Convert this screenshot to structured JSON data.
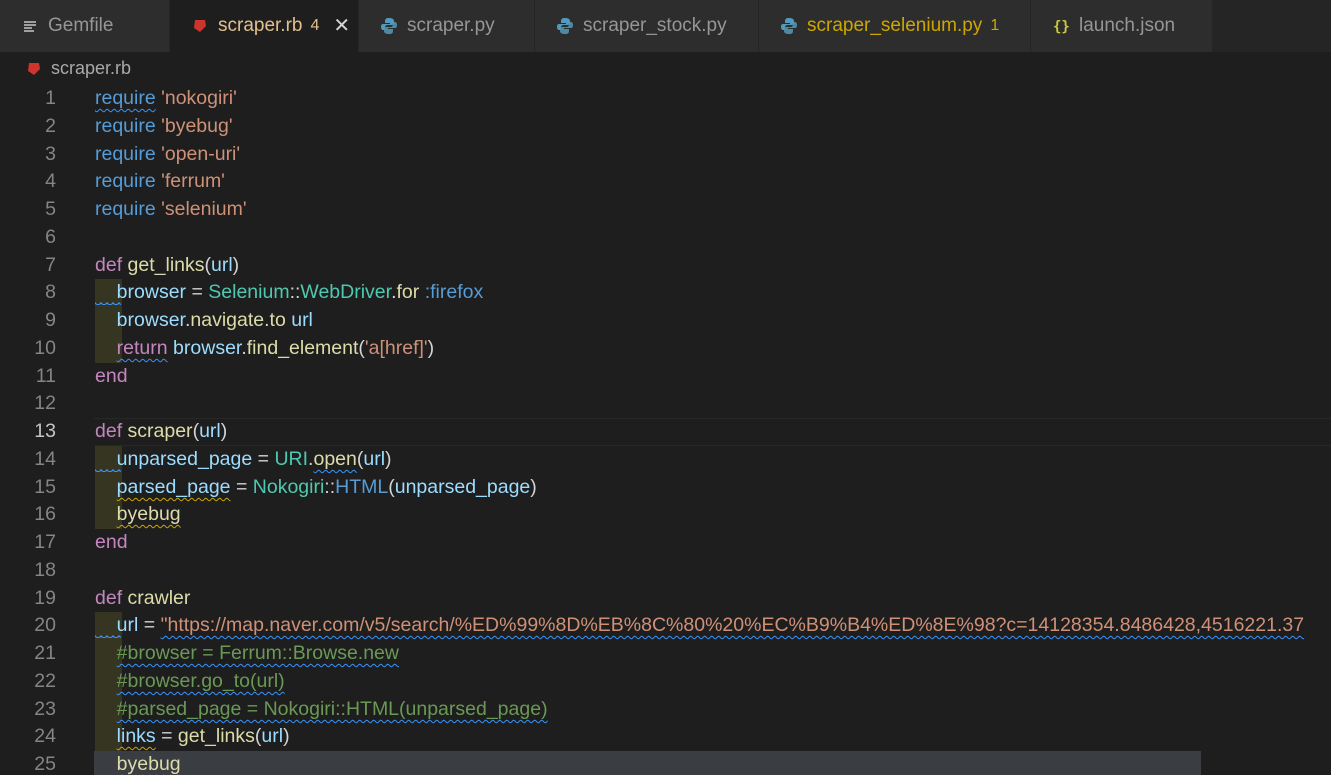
{
  "tabs": [
    {
      "label": "Gemfile",
      "icon": "lines-icon",
      "active": false,
      "badge": "",
      "status": "none"
    },
    {
      "label": "scraper.rb",
      "icon": "ruby-icon",
      "active": true,
      "badge": "4",
      "status": "modified"
    },
    {
      "label": "scraper.py",
      "icon": "python-icon",
      "active": false,
      "badge": "",
      "status": "none"
    },
    {
      "label": "scraper_stock.py",
      "icon": "python-icon",
      "active": false,
      "badge": "",
      "status": "none"
    },
    {
      "label": "scraper_selenium.py",
      "icon": "python-icon",
      "active": false,
      "badge": "1",
      "status": "warning"
    },
    {
      "label": "launch.json",
      "icon": "braces-icon",
      "active": false,
      "badge": "",
      "status": "none"
    }
  ],
  "breadcrumb": {
    "file": "scraper.rb",
    "icon": "ruby-icon"
  },
  "colors": {
    "ruby": "#cc342d",
    "python": "#519aba",
    "json": "#cbcb41",
    "keyword": "#569cd6",
    "control": "#c586c0",
    "string": "#ce9178",
    "function": "#dcdcaa",
    "variable": "#9cdcfe",
    "class": "#4ec9b0",
    "comment": "#6a9955"
  },
  "editor": {
    "current_line": 13,
    "lines": [
      {
        "n": "1",
        "t": [
          [
            "kw sq-b",
            "require"
          ],
          [
            "p",
            " "
          ],
          [
            "str",
            "'nokogiri'"
          ]
        ]
      },
      {
        "n": "2",
        "t": [
          [
            "kw",
            "require"
          ],
          [
            "p",
            " "
          ],
          [
            "str",
            "'byebug'"
          ]
        ]
      },
      {
        "n": "3",
        "t": [
          [
            "kw",
            "require"
          ],
          [
            "p",
            " "
          ],
          [
            "str",
            "'open-uri'"
          ]
        ]
      },
      {
        "n": "4",
        "t": [
          [
            "kw",
            "require"
          ],
          [
            "p",
            " "
          ],
          [
            "str",
            "'ferrum'"
          ]
        ]
      },
      {
        "n": "5",
        "t": [
          [
            "kw",
            "require"
          ],
          [
            "p",
            " "
          ],
          [
            "str",
            "'selenium'"
          ]
        ]
      },
      {
        "n": "6",
        "t": []
      },
      {
        "n": "7",
        "t": [
          [
            "kd",
            "def"
          ],
          [
            "p",
            " "
          ],
          [
            "fn",
            "get_links"
          ],
          [
            "p",
            "("
          ],
          [
            "var",
            "url"
          ],
          [
            "p",
            ")"
          ]
        ]
      },
      {
        "n": "8",
        "indent": true,
        "sq": true,
        "t": [
          [
            "p",
            "    "
          ],
          [
            "var",
            "browser"
          ],
          [
            "p",
            " = "
          ],
          [
            "cls",
            "Selenium"
          ],
          [
            "p",
            "::"
          ],
          [
            "cls",
            "WebDriver"
          ],
          [
            "p",
            "."
          ],
          [
            "fn",
            "for"
          ],
          [
            "p",
            " "
          ],
          [
            "sym",
            ":firefox"
          ]
        ]
      },
      {
        "n": "9",
        "indent": true,
        "t": [
          [
            "p",
            "    "
          ],
          [
            "var",
            "browser"
          ],
          [
            "p",
            "."
          ],
          [
            "fn",
            "navigate"
          ],
          [
            "p",
            "."
          ],
          [
            "fn",
            "to"
          ],
          [
            "p",
            " "
          ],
          [
            "var",
            "url"
          ]
        ]
      },
      {
        "n": "10",
        "indent": true,
        "t": [
          [
            "p",
            "    "
          ],
          [
            "kd sq-b",
            "return"
          ],
          [
            "p",
            " "
          ],
          [
            "var",
            "browser"
          ],
          [
            "p",
            "."
          ],
          [
            "fn",
            "find_element"
          ],
          [
            "p",
            "("
          ],
          [
            "str",
            "'a[href]'"
          ],
          [
            "p",
            ")"
          ]
        ]
      },
      {
        "n": "11",
        "t": [
          [
            "kd",
            "end"
          ]
        ]
      },
      {
        "n": "12",
        "t": []
      },
      {
        "n": "13",
        "t": [
          [
            "kd",
            "def"
          ],
          [
            "p",
            " "
          ],
          [
            "fn",
            "scraper"
          ],
          [
            "p",
            "("
          ],
          [
            "var",
            "url"
          ],
          [
            "p",
            ")"
          ]
        ]
      },
      {
        "n": "14",
        "indent": true,
        "sq": true,
        "t": [
          [
            "p",
            "    "
          ],
          [
            "var",
            "unparsed_page"
          ],
          [
            "p",
            " = "
          ],
          [
            "cls",
            "URI"
          ],
          [
            "p",
            "."
          ],
          [
            "fn sq-b",
            "open"
          ],
          [
            "p",
            "("
          ],
          [
            "var",
            "url"
          ],
          [
            "p",
            ")"
          ]
        ]
      },
      {
        "n": "15",
        "indent": true,
        "t": [
          [
            "p",
            "    "
          ],
          [
            "var sq-y",
            "parsed_page"
          ],
          [
            "p",
            " = "
          ],
          [
            "cls",
            "Nokogiri"
          ],
          [
            "p",
            "::"
          ],
          [
            "kw",
            "HTML"
          ],
          [
            "p",
            "("
          ],
          [
            "var",
            "unparsed_page"
          ],
          [
            "p",
            ")"
          ]
        ]
      },
      {
        "n": "16",
        "indent": true,
        "t": [
          [
            "p",
            "    "
          ],
          [
            "fn sq-y",
            "byebug"
          ]
        ]
      },
      {
        "n": "17",
        "t": [
          [
            "kd",
            "end"
          ]
        ]
      },
      {
        "n": "18",
        "t": []
      },
      {
        "n": "19",
        "t": [
          [
            "kd",
            "def"
          ],
          [
            "p",
            " "
          ],
          [
            "fn",
            "crawler"
          ]
        ]
      },
      {
        "n": "20",
        "indent": true,
        "sq": true,
        "t": [
          [
            "p",
            "    "
          ],
          [
            "var",
            "url"
          ],
          [
            "p",
            " = "
          ],
          [
            "str sq-b",
            "\"https://map.naver.com/v5/search/%ED%99%8D%EB%8C%80%20%EC%B9%B4%ED%8E%98?c=14128354.8486428,4516221.37"
          ]
        ]
      },
      {
        "n": "21",
        "indent": true,
        "t": [
          [
            "p",
            "    "
          ],
          [
            "cmt sq-b",
            "#browser = Ferrum::Browse.new"
          ]
        ]
      },
      {
        "n": "22",
        "indent": true,
        "t": [
          [
            "p",
            "    "
          ],
          [
            "cmt sq-b",
            "#browser.go_to(url)"
          ]
        ]
      },
      {
        "n": "23",
        "indent": true,
        "t": [
          [
            "p",
            "    "
          ],
          [
            "cmt sq-b",
            "#parsed_page = Nokogiri::HTML(unparsed_page)"
          ]
        ]
      },
      {
        "n": "24",
        "indent": true,
        "t": [
          [
            "p",
            "    "
          ],
          [
            "var sq-y",
            "links"
          ],
          [
            "p",
            " = "
          ],
          [
            "fn",
            "get_links"
          ],
          [
            "p",
            "("
          ],
          [
            "var",
            "url"
          ],
          [
            "p",
            ")"
          ]
        ]
      },
      {
        "n": "25",
        "indent": true,
        "selected": true,
        "t": [
          [
            "p",
            "    "
          ],
          [
            "fn sq-y",
            "byebug"
          ]
        ]
      }
    ]
  }
}
